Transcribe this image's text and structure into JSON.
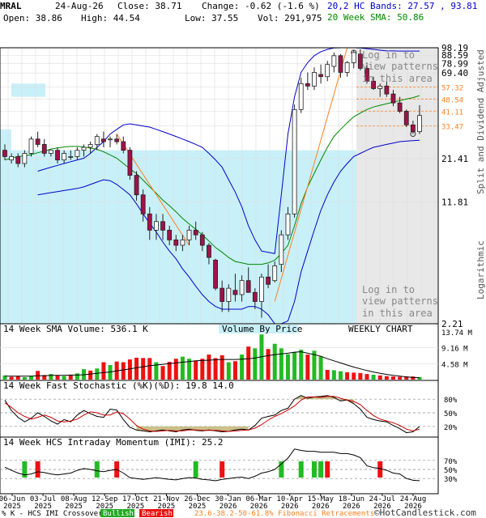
{
  "header": {
    "symbol": "MRAL",
    "date": "24-Aug-26",
    "close": "Close: 38.71",
    "change": "Change: -0.62 (-1.6 %)",
    "open": "Open: 38.86",
    "high": "High: 44.54",
    "low": "Low: 37.55",
    "vol": "Vol: 291,975",
    "bands": "20,2 HC Bands: 27.57 , 93.81",
    "sma": "20 Week SMA: 50.86"
  },
  "labels": {
    "side_top": "Split and Dividend Adjusted",
    "side_bottom": "Logarithmic",
    "login_top": [
      "Log in to",
      "view patterns",
      "in this area"
    ],
    "login_bottom": [
      "Log in to",
      "view patterns",
      "in this area"
    ],
    "vol_title": "14 Week SMA Volume: 536.1 K",
    "vbp": "Volume By Price",
    "weekly": "WEEKLY CHART",
    "stoch_title": "14 Week Fast Stochastic (%K)(%D): 19.8 14.0",
    "imi_title": "14 Week HCS Intraday Momentum (IMI): 25.2",
    "footer_prefix": "% K - HCS IMI Crossover:",
    "bullish": "Bullish",
    "bearish": "Bearish",
    "fib": "23.6-38.2-50-61.8% Fibonacci Retracements",
    "copyright": "©HotCandlestick.com"
  },
  "colors": {
    "bull": "#ffffff",
    "bear": "#a0124a",
    "cyan": "#c8f0f8",
    "grey": "#e8e8e8",
    "blue": "#0000cc",
    "green": "#008800",
    "orange": "#ff7f1e",
    "volgreen": "#22bb22",
    "volred": "#ee1111"
  },
  "chart_data": [
    {
      "type": "candlestick",
      "title": "MRAL weekly",
      "y_scale": "log",
      "ylim": [
        2.21,
        98.19
      ],
      "y_ticks": [
        "98.19",
        "88.59",
        "78.99",
        "69.40",
        "21.41",
        "11.81",
        "2.21"
      ],
      "fib_levels": [
        "57.32",
        "48.54",
        "41.11",
        "33.47"
      ],
      "x_ticks": [
        [
          "06-Jun",
          "2025"
        ],
        [
          "03-Jul",
          "2025"
        ],
        [
          "08-Aug",
          "2025"
        ],
        [
          "12-Sep",
          "2025"
        ],
        [
          "17-Oct",
          "2025"
        ],
        [
          "21-Nov",
          "2025"
        ],
        [
          "26-Dec",
          "2025"
        ],
        [
          "30-Jan",
          "2026"
        ],
        [
          "06-Mar",
          "2026"
        ],
        [
          "10-Apr",
          "2026"
        ],
        [
          "15-May",
          "2026"
        ],
        [
          "18-Jun",
          "2026"
        ],
        [
          "24-Jul",
          "2026"
        ],
        [
          "24-Aug",
          "2026"
        ]
      ],
      "ohlc": [
        [
          24,
          26,
          21,
          22
        ],
        [
          21,
          23,
          20,
          22
        ],
        [
          22,
          23,
          19,
          20
        ],
        [
          20,
          24,
          19,
          23
        ],
        [
          23,
          29,
          22,
          28
        ],
        [
          28,
          31,
          25,
          26
        ],
        [
          26,
          28,
          22,
          23
        ],
        [
          23,
          24,
          22,
          24
        ],
        [
          24,
          25,
          20,
          21
        ],
        [
          21,
          24,
          20,
          23
        ],
        [
          22,
          24,
          21,
          22
        ],
        [
          22,
          25,
          21,
          24
        ],
        [
          24,
          26,
          22,
          25
        ],
        [
          25,
          27,
          23,
          26
        ],
        [
          26,
          30,
          24,
          29
        ],
        [
          28,
          31,
          25,
          27
        ],
        [
          28,
          29,
          25,
          28
        ],
        [
          28,
          30,
          26,
          27
        ],
        [
          27,
          29,
          23,
          24
        ],
        [
          24,
          25,
          16,
          17
        ],
        [
          17,
          18,
          12,
          13
        ],
        [
          13,
          14,
          9,
          10
        ],
        [
          10,
          11,
          7,
          8
        ],
        [
          8,
          10,
          7,
          9
        ],
        [
          9,
          10,
          7,
          8
        ],
        [
          8,
          8.5,
          6.5,
          7
        ],
        [
          7,
          7.5,
          6,
          6.5
        ],
        [
          6.5,
          7.5,
          6,
          7
        ],
        [
          7,
          8.5,
          6.5,
          8
        ],
        [
          8,
          9,
          7,
          7.5
        ],
        [
          7.5,
          7.8,
          6,
          6.5
        ],
        [
          6.5,
          6.7,
          5,
          5.5
        ],
        [
          5.3,
          5.4,
          3.5,
          3.6
        ],
        [
          3.6,
          4,
          2.6,
          3
        ],
        [
          3,
          3.8,
          2.6,
          3.6
        ],
        [
          3.5,
          4.4,
          3,
          3.3
        ],
        [
          3.3,
          4.3,
          3,
          4
        ],
        [
          4,
          4.8,
          3.4,
          3.4
        ],
        [
          3.4,
          3.6,
          2.7,
          3
        ],
        [
          3,
          4.4,
          2.4,
          4.2
        ],
        [
          4.2,
          5,
          3.6,
          3.8
        ],
        [
          4,
          5.2,
          3.9,
          4.9
        ],
        [
          5,
          8,
          4.5,
          7.5
        ],
        [
          7.5,
          11,
          7,
          10
        ],
        [
          10,
          45,
          9.5,
          42
        ],
        [
          42,
          65,
          40,
          60
        ],
        [
          60,
          70,
          55,
          58
        ],
        [
          58,
          75,
          55,
          70
        ],
        [
          68,
          78,
          60,
          66
        ],
        [
          66,
          82,
          62,
          78
        ],
        [
          76,
          92,
          70,
          88
        ],
        [
          88,
          90,
          65,
          70
        ],
        [
          70,
          82,
          66,
          80
        ],
        [
          80,
          95,
          74,
          92
        ],
        [
          90,
          96,
          72,
          74
        ],
        [
          74,
          80,
          60,
          62
        ],
        [
          62,
          66,
          55,
          56
        ],
        [
          56,
          60,
          50,
          58
        ],
        [
          58,
          62,
          50,
          52
        ],
        [
          52,
          55,
          44,
          46
        ],
        [
          46,
          50,
          40,
          41
        ],
        [
          41,
          42,
          33,
          34
        ],
        [
          34,
          36,
          30,
          31
        ],
        [
          31,
          44.54,
          30,
          38.71
        ]
      ],
      "sma20": [
        21,
        21.5,
        22,
        22.2,
        22.6,
        23.2,
        23.7,
        24.4,
        24.8,
        25.1,
        25.3,
        25.3,
        25.1,
        24.7,
        24.3,
        23.5,
        22.5,
        21.5,
        20,
        18.6,
        17.4,
        15.9,
        14.5,
        13.3,
        12.1,
        11.2,
        10.3,
        9.4,
        8.7,
        8.1,
        7.5,
        6.9,
        6.3,
        5.9,
        5.5,
        5.2,
        5.1,
        5,
        5,
        5,
        5.1,
        5.3,
        5.8,
        6.5,
        8.5,
        11.5,
        14.5,
        17.5,
        21,
        25,
        29,
        32,
        35,
        38,
        40,
        42,
        43.5,
        44.5,
        45.5,
        46.5,
        47.5,
        48.5,
        49.5,
        50.86
      ],
      "band_upper": [
        null,
        null,
        null,
        null,
        null,
        18,
        18.5,
        19,
        19.5,
        20,
        20.5,
        21,
        21.5,
        23,
        25,
        27,
        30,
        32,
        34,
        34.5,
        34,
        33.5,
        33,
        32,
        31,
        30,
        29,
        28,
        27,
        26,
        25,
        23,
        21,
        19,
        16,
        13.5,
        11,
        8.5,
        7,
        6,
        5.9,
        5.8,
        13,
        30,
        50,
        70,
        80,
        88,
        93,
        96,
        98,
        99,
        99,
        99,
        98,
        97,
        96,
        95,
        94,
        94,
        93.8,
        93.8,
        93.8,
        93.81
      ],
      "band_lower": [
        null,
        null,
        null,
        null,
        null,
        13,
        13.2,
        13.4,
        13.6,
        13.8,
        14,
        14.2,
        14.5,
        15,
        15.5,
        16,
        15.8,
        15,
        14,
        13,
        11.5,
        10,
        8.8,
        7.8,
        6.8,
        6,
        5.4,
        4.7,
        4.2,
        3.7,
        3.3,
        3,
        2.8,
        2.7,
        2.7,
        2.7,
        2.7,
        2.8,
        2.8,
        2.7,
        2.5,
        1.9,
        2,
        2.3,
        3,
        4.5,
        6,
        8,
        10.5,
        13,
        15.5,
        18,
        20,
        22,
        23,
        24,
        25,
        25.5,
        26,
        26.5,
        27,
        27.2,
        27.4,
        27.57
      ]
    },
    {
      "type": "bar",
      "title": "14 Week SMA Volume",
      "y_ticks": [
        "13.74 M",
        "9.16 M",
        "4.58 M"
      ],
      "ylim": [
        0,
        13.74
      ],
      "values_M": [
        1.2,
        0.8,
        1.0,
        0.7,
        1.1,
        2.5,
        1.3,
        1.6,
        1.2,
        1.0,
        1.4,
        1.8,
        3.0,
        2.6,
        3.2,
        5.0,
        4.2,
        5.2,
        5.0,
        5.8,
        6.3,
        6.2,
        6.2,
        5.0,
        3.9,
        5.1,
        6.0,
        6.6,
        6.0,
        5.4,
        6.0,
        7.2,
        6.2,
        7.0,
        5.0,
        5.3,
        7.2,
        9.5,
        9.0,
        13.0,
        8.8,
        10.3,
        9.0,
        7.3,
        7.8,
        8.6,
        7.2,
        8.3,
        6.7,
        2.8,
        2.7,
        2.4,
        2.1,
        2.0,
        1.9,
        1.6,
        1.4,
        1.2,
        1.0,
        0.9,
        0.8,
        0.9,
        0.9,
        0.7
      ],
      "up": [
        true,
        false,
        false,
        true,
        true,
        false,
        false,
        true,
        false,
        true,
        false,
        true,
        true,
        false,
        true,
        false,
        true,
        false,
        false,
        false,
        false,
        false,
        false,
        true,
        false,
        false,
        false,
        true,
        true,
        false,
        false,
        false,
        false,
        false,
        true,
        false,
        true,
        false,
        true,
        true,
        false,
        true,
        true,
        true,
        true,
        true,
        false,
        true,
        true,
        false,
        true,
        true,
        false,
        false,
        false,
        false,
        true,
        false,
        false,
        false,
        false,
        false,
        false,
        true
      ],
      "sma_M": [
        1.0,
        1.0,
        1.0,
        1.0,
        1.0,
        1.1,
        1.1,
        1.2,
        1.2,
        1.2,
        1.3,
        1.3,
        1.4,
        1.6,
        1.8,
        2.0,
        2.2,
        2.5,
        2.8,
        3.1,
        3.4,
        3.7,
        4.0,
        4.2,
        4.4,
        4.6,
        4.8,
        5.0,
        5.2,
        5.4,
        5.5,
        5.6,
        5.7,
        5.8,
        5.8,
        5.8,
        5.9,
        6.0,
        6.2,
        6.6,
        6.9,
        7.2,
        7.4,
        7.6,
        7.9,
        8.0,
        7.6,
        7.2,
        6.7,
        6.0,
        5.4,
        4.8,
        4.2,
        3.6,
        3.1,
        2.6,
        2.2,
        1.8,
        1.5,
        1.2,
        1.0,
        0.8,
        0.6,
        0.54
      ]
    },
    {
      "type": "line",
      "title": "14 Week Fast Stochastic",
      "y_ticks": [
        "80%",
        "50%",
        "20%"
      ],
      "ylim": [
        0,
        100
      ],
      "k": [
        78,
        55,
        40,
        30,
        38,
        50,
        42,
        32,
        25,
        35,
        30,
        45,
        55,
        48,
        42,
        40,
        58,
        56,
        35,
        18,
        12,
        10,
        8,
        10,
        12,
        10,
        8,
        12,
        14,
        11,
        10,
        12,
        10,
        8,
        9,
        12,
        14,
        12,
        22,
        38,
        42,
        45,
        55,
        60,
        80,
        88,
        82,
        85,
        86,
        88,
        84,
        76,
        78,
        70,
        58,
        40,
        35,
        32,
        30,
        22,
        15,
        6,
        8,
        19.8
      ],
      "d": [
        72,
        62,
        50,
        42,
        36,
        40,
        45,
        40,
        32,
        30,
        32,
        36,
        45,
        52,
        50,
        45,
        45,
        52,
        48,
        36,
        22,
        14,
        10,
        9,
        10,
        11,
        10,
        10,
        12,
        12,
        11,
        11,
        11,
        10,
        9,
        10,
        11,
        12,
        16,
        24,
        34,
        42,
        48,
        56,
        65,
        78,
        85,
        85,
        84,
        86,
        86,
        82,
        78,
        75,
        68,
        55,
        44,
        36,
        32,
        28,
        22,
        14,
        10,
        14.0
      ]
    },
    {
      "type": "line",
      "title": "14 Week HCS Intraday Momentum",
      "y_ticks": [
        "70%",
        "50%",
        "30%"
      ],
      "ylim": [
        0,
        100
      ],
      "imi": [
        55,
        48,
        42,
        38,
        40,
        45,
        43,
        40,
        38,
        40,
        42,
        48,
        52,
        50,
        47,
        45,
        48,
        50,
        42,
        32,
        30,
        28,
        30,
        32,
        30,
        28,
        27,
        30,
        32,
        31,
        28,
        27,
        25,
        28,
        30,
        32,
        33,
        30,
        35,
        42,
        45,
        50,
        62,
        75,
        95,
        92,
        90,
        90,
        88,
        88,
        88,
        85,
        85,
        82,
        76,
        58,
        54,
        52,
        48,
        42,
        40,
        30,
        26,
        25.2
      ],
      "crossovers_bull": [
        3,
        14,
        29,
        42,
        45,
        47,
        48
      ],
      "crossovers_bear": [
        5,
        17,
        33,
        49,
        57
      ]
    }
  ]
}
